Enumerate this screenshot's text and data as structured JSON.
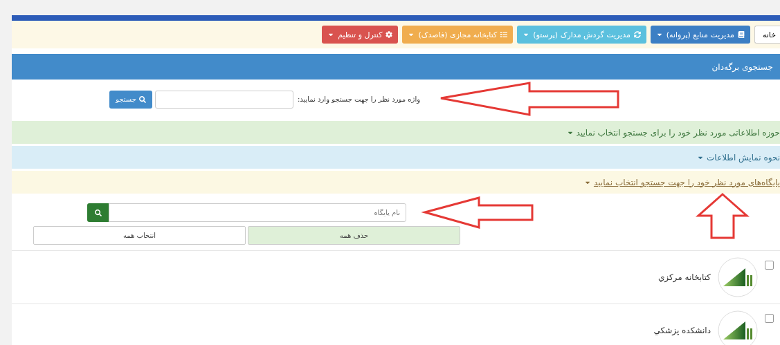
{
  "toolbar": {
    "search": {
      "value": "خانه"
    },
    "menus": [
      {
        "label": "مدیریت منابع (پروانه)",
        "color": "#3c7fc4"
      },
      {
        "label": "مدیریت گردش مدارک (پرستو)",
        "color": "#5bc0de"
      },
      {
        "label": "کتابخانه مجازی (فاصدک)",
        "color": "#f0ad4e"
      },
      {
        "label": "کنترل و تنظیم",
        "color": "#d9534f"
      }
    ]
  },
  "panel": {
    "title": "جستجوی برگه‌دان"
  },
  "term_search": {
    "label": "واژه مورد نظر را جهت جستجو وارد نمایید:",
    "button": "جستجو"
  },
  "sections": [
    {
      "label": "حوزه اطلاعاتی مورد نظر خود را برای جستجو انتخاب نمایید",
      "kind": "success",
      "hovered": false
    },
    {
      "label": "نحوه نمایش اطلاعات",
      "kind": "info",
      "hovered": false
    },
    {
      "label": "پایگاه‌های مورد نظر خود را جهت جستجو انتخاب نمایید",
      "kind": "warning",
      "hovered": true
    }
  ],
  "base_search": {
    "placeholder": "نام پایگاه"
  },
  "toggles": [
    {
      "label": "حذف همه",
      "selected": true
    },
    {
      "label": "انتخاب همه",
      "selected": false
    }
  ],
  "bases": [
    {
      "name": "کتابخانه مرکزي",
      "checked": false
    },
    {
      "name": "دانشکده پزشکي",
      "checked": false
    }
  ]
}
